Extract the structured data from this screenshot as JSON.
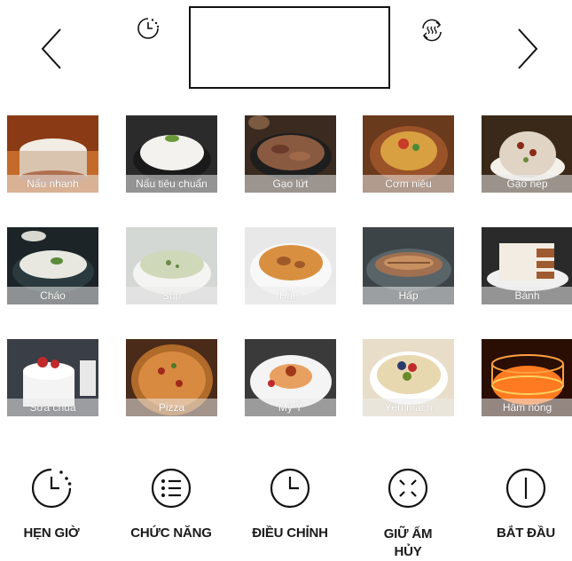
{
  "display": {
    "text": ""
  },
  "nav": {
    "prev_icon": "chevron-left-icon",
    "next_icon": "chevron-right-icon",
    "timer_icon": "timer-icon",
    "steam_icon": "steam-cycle-icon"
  },
  "programs": [
    {
      "label": "Nấu nhanh",
      "bg": "#c46a2a",
      "fg": "#f1ece4"
    },
    {
      "label": "Nấu tiêu chuẩn",
      "bg": "#2b2b2b",
      "fg": "#f4f2ee"
    },
    {
      "label": "Gạo lứt",
      "bg": "#3a2a20",
      "fg": "#8a5a40"
    },
    {
      "label": "Cơm niêu",
      "bg": "#6a3a1c",
      "fg": "#d8a040"
    },
    {
      "label": "Gạo nếp",
      "bg": "#3a2818",
      "fg": "#e0d4c4"
    },
    {
      "label": "Cháo",
      "bg": "#1c2428",
      "fg": "#e8e8e0"
    },
    {
      "label": "Súp",
      "bg": "#d4d8d4",
      "fg": "#cfd8b8"
    },
    {
      "label": "Hầm",
      "bg": "#e8e8e8",
      "fg": "#d89040"
    },
    {
      "label": "Hấp",
      "bg": "#3c4448",
      "fg": "#a07050"
    },
    {
      "label": "Bánh",
      "bg": "#2a2a2a",
      "fg": "#f2ece2"
    },
    {
      "label": "Sữa chua",
      "bg": "#3a3e46",
      "fg": "#f4f4f4"
    },
    {
      "label": "Pizza",
      "bg": "#4a2a18",
      "fg": "#d88a40"
    },
    {
      "label": "Mỳ Ý",
      "bg": "#3a3a3a",
      "fg": "#e8a060"
    },
    {
      "label": "Yến mạch",
      "bg": "#e8ddc8",
      "fg": "#e8d8b0"
    },
    {
      "label": "Hâm nóng",
      "bg": "#2a0e04",
      "fg": "#ff7a20"
    }
  ],
  "controls": [
    {
      "label": "HẸN GIỜ",
      "icon": "timer-icon"
    },
    {
      "label": "CHỨC NĂNG",
      "icon": "menu-list-icon"
    },
    {
      "label": "ĐIỀU CHỈNH",
      "icon": "clock-icon"
    },
    {
      "label": "GIỮ ẤM\nHỦY",
      "icon": "keep-warm-cancel-icon"
    },
    {
      "label": "BẮT ĐẦU",
      "icon": "power-start-icon"
    }
  ]
}
